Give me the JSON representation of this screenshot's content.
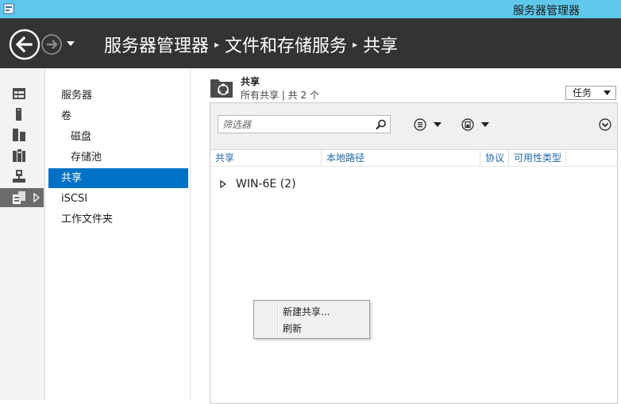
{
  "window": {
    "title": "服务器管理器"
  },
  "header": {
    "breadcrumb": [
      "服务器管理器",
      "文件和存储服务",
      "共享"
    ]
  },
  "rail": {
    "items": [
      {
        "icon": "dashboard-icon"
      },
      {
        "icon": "local-server-icon"
      },
      {
        "icon": "all-servers-icon"
      },
      {
        "icon": "iis-icon"
      },
      {
        "icon": "network-icon"
      },
      {
        "icon": "file-storage-icon",
        "active": true
      }
    ]
  },
  "nav": {
    "items": [
      {
        "label": "服务器"
      },
      {
        "label": "卷"
      },
      {
        "label": "磁盘"
      },
      {
        "label": "存储池"
      },
      {
        "label": "共享"
      },
      {
        "label": "iSCSI"
      },
      {
        "label": "工作文件夹"
      }
    ]
  },
  "tile": {
    "title": "共享",
    "subtitle": "所有共享 | 共 2 个",
    "tasks_label": "任务"
  },
  "toolbar": {
    "filter_placeholder": "筛选器"
  },
  "columns": [
    "共享",
    "本地路径",
    "协议",
    "可用性类型"
  ],
  "group": {
    "label": "WIN-6E (2)"
  },
  "context_menu": {
    "items": [
      "新建共享...",
      "刷新"
    ]
  },
  "colors": {
    "titlebar": "#5ec7ea",
    "header": "#333333",
    "selection": "#0072c6",
    "column_header_text": "#1f67a8"
  }
}
